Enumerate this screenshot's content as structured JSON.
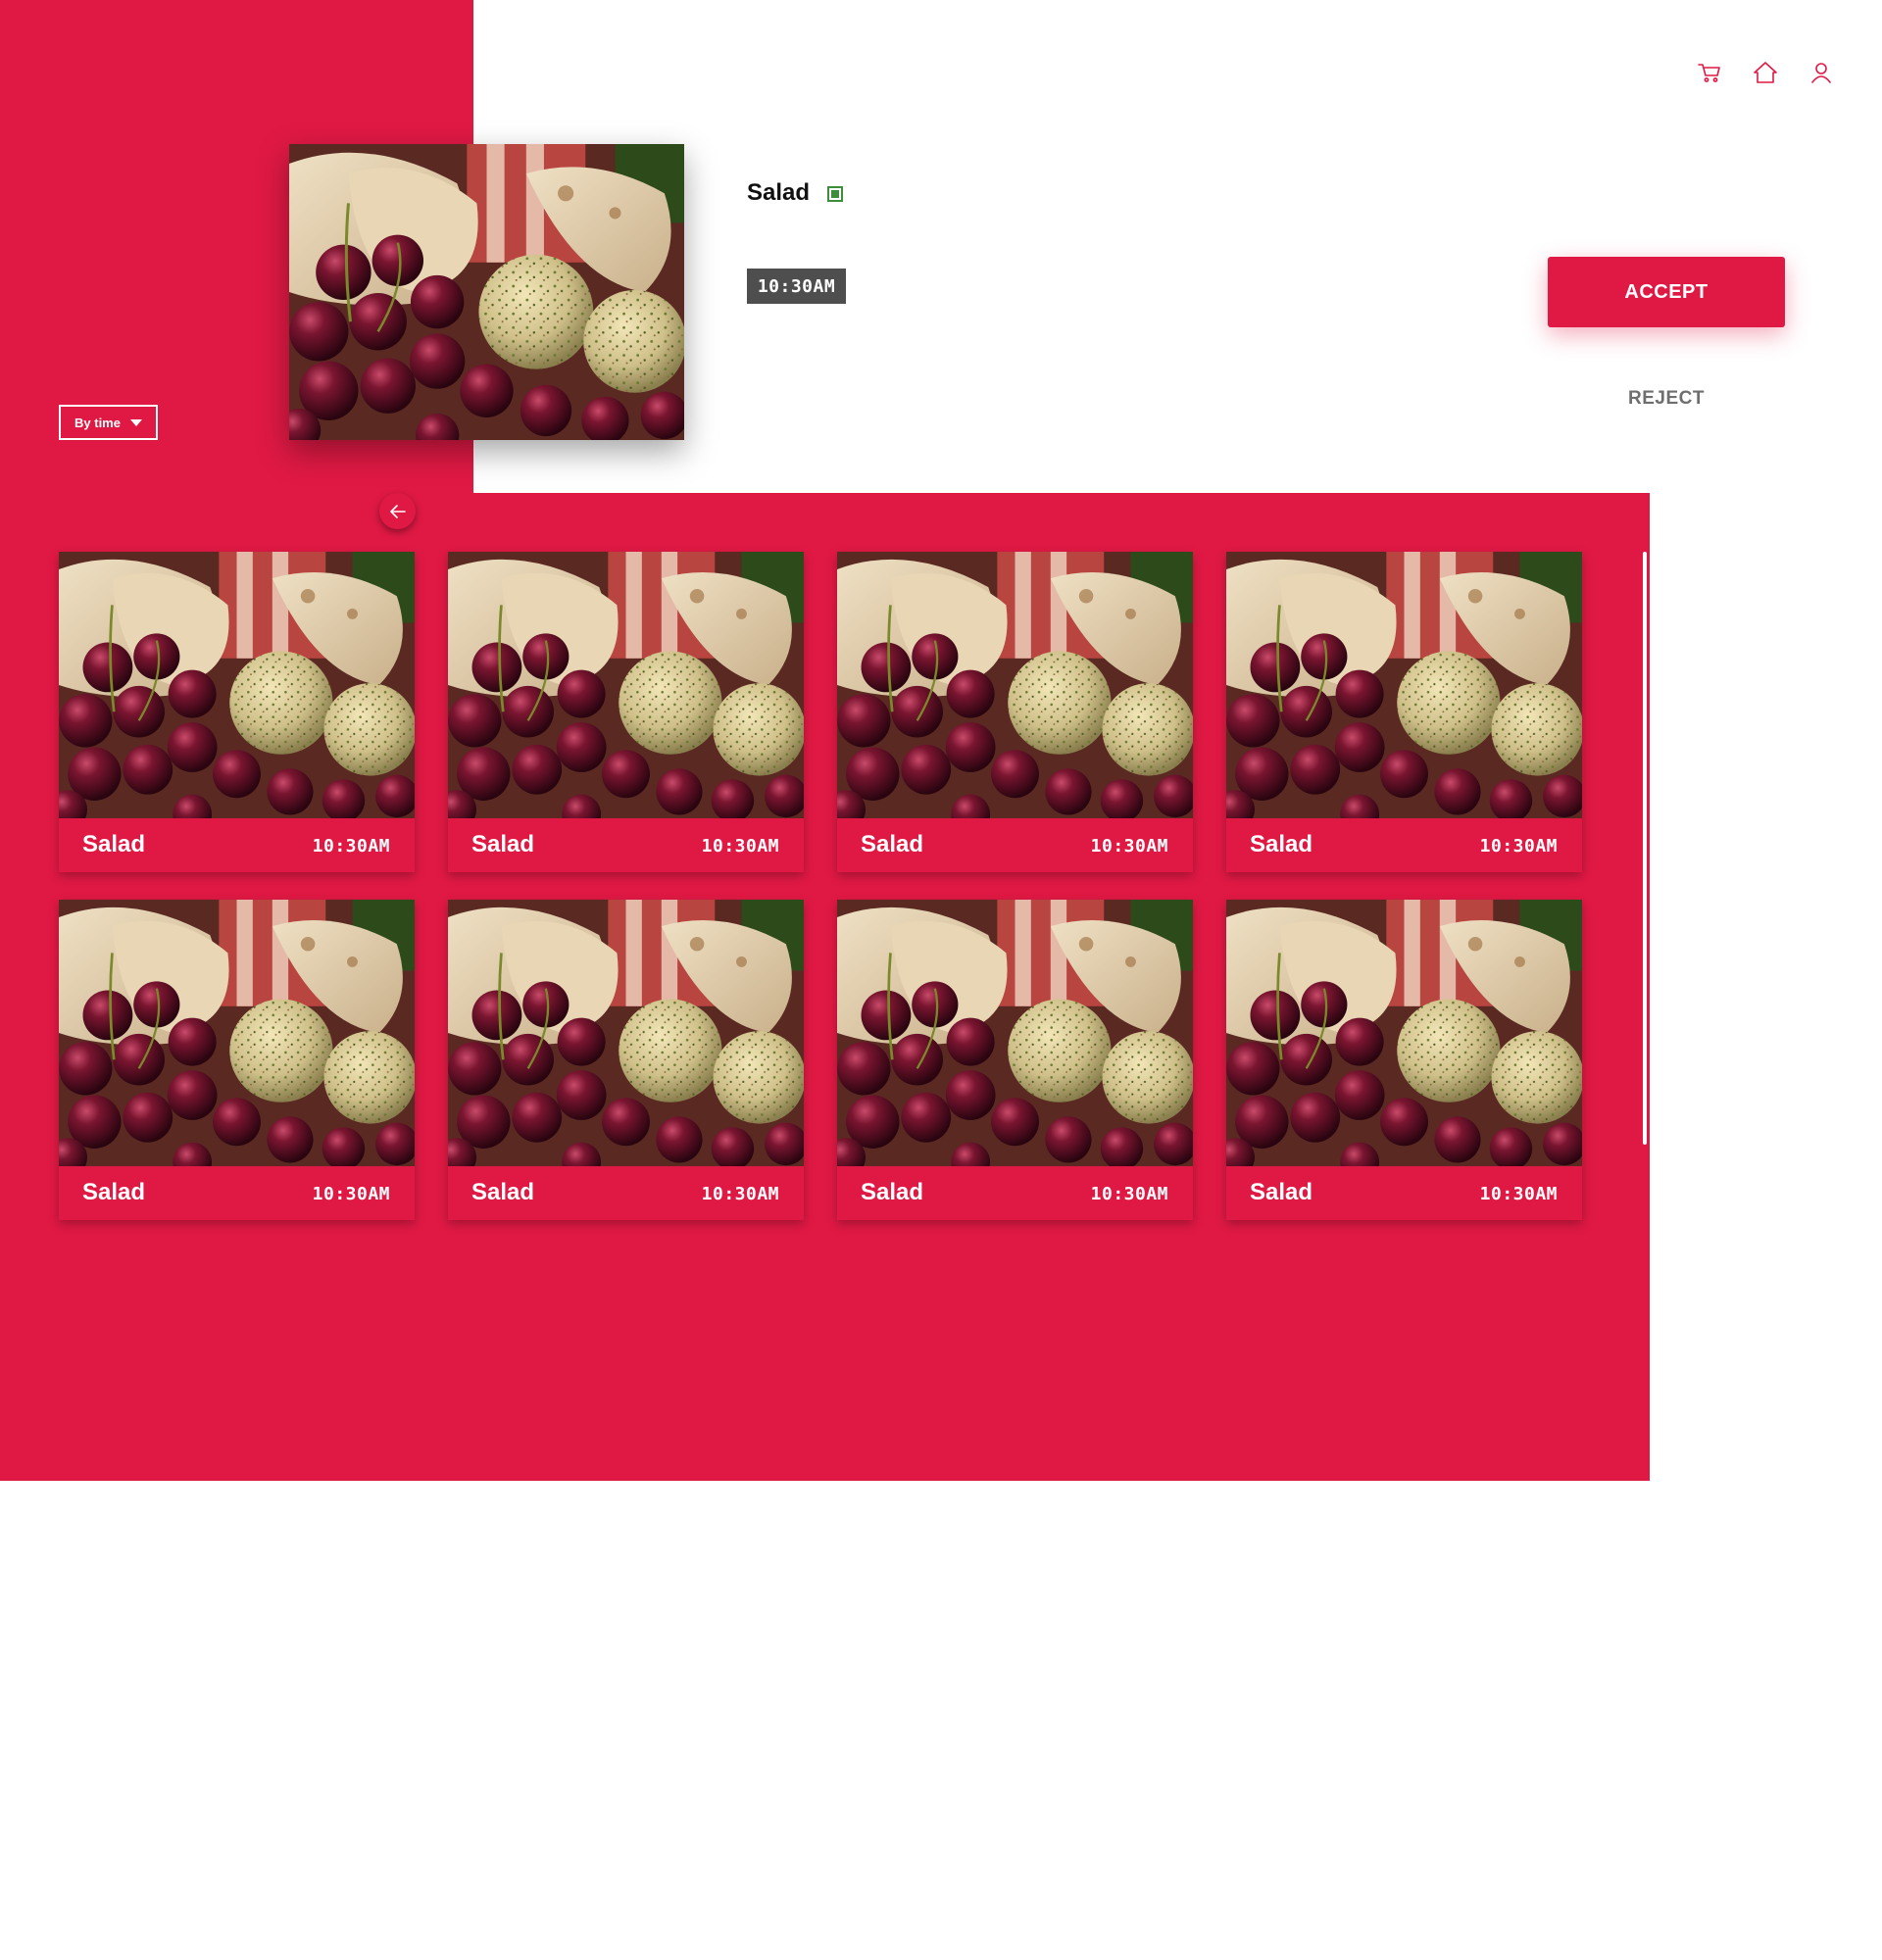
{
  "colors": {
    "brand_red": "#e01944",
    "veg_green": "#3d8d3a",
    "badge_gray": "#4e4e4e"
  },
  "header": {
    "icons": [
      "cart-icon",
      "home-icon",
      "user-icon"
    ]
  },
  "selected_order": {
    "title": "Salad",
    "time": "10:30AM",
    "image": "food-platter-cherries-cheese-balls",
    "accept_label": "ACCEPT",
    "reject_label": "REJECT"
  },
  "sort": {
    "label": "By time"
  },
  "orders": [
    {
      "name": "Salad",
      "time": "10:30AM"
    },
    {
      "name": "Salad",
      "time": "10:30AM"
    },
    {
      "name": "Salad",
      "time": "10:30AM"
    },
    {
      "name": "Salad",
      "time": "10:30AM"
    },
    {
      "name": "Salad",
      "time": "10:30AM"
    },
    {
      "name": "Salad",
      "time": "10:30AM"
    },
    {
      "name": "Salad",
      "time": "10:30AM"
    },
    {
      "name": "Salad",
      "time": "10:30AM"
    }
  ]
}
